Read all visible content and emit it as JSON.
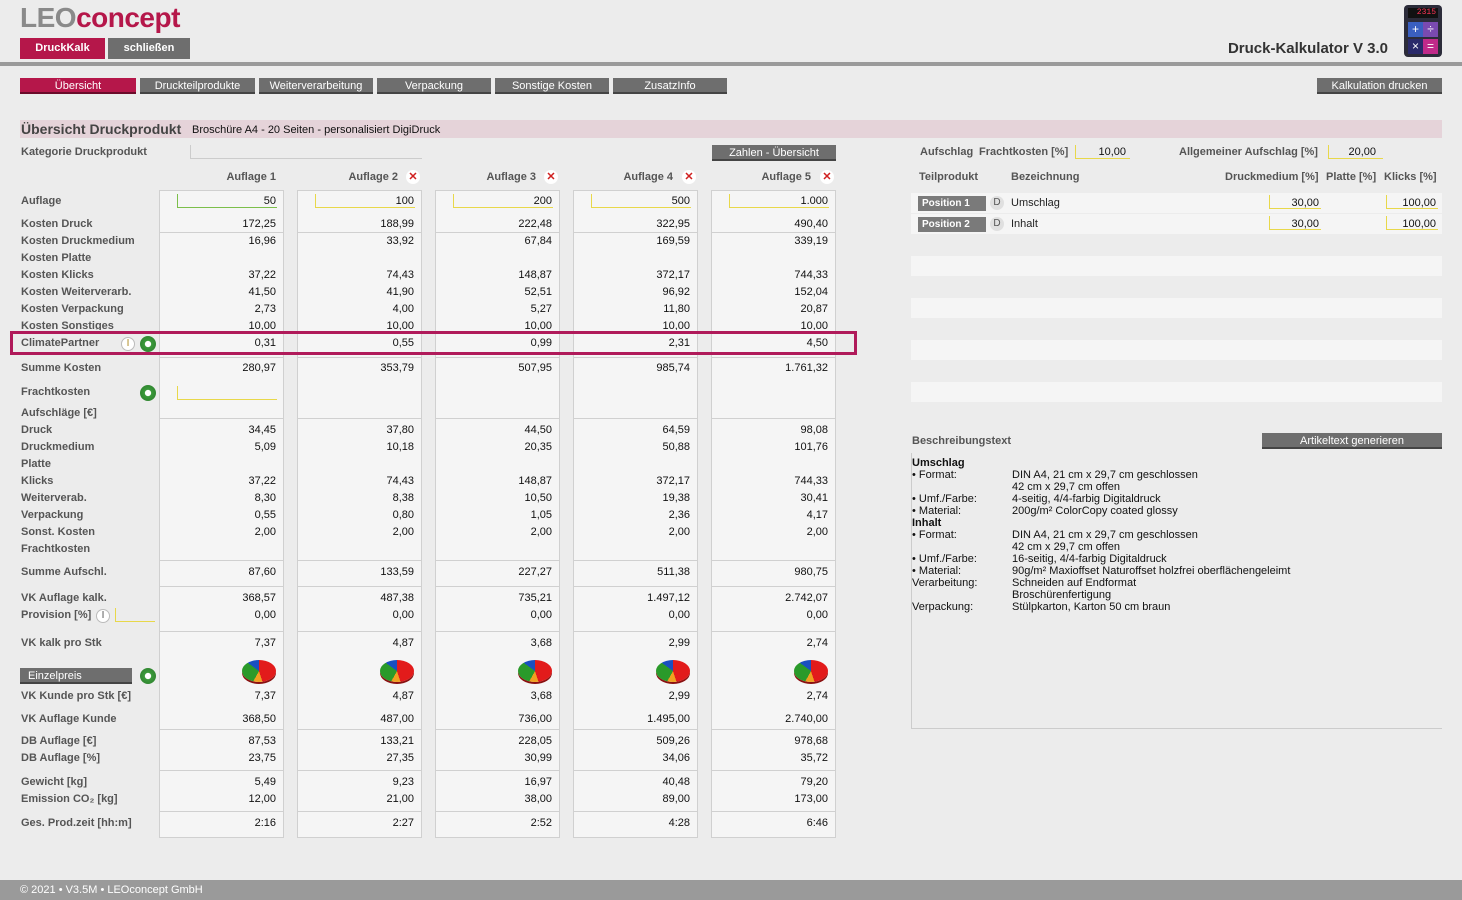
{
  "app": {
    "logo_a": "LEO",
    "logo_b": "concept",
    "title": "Druck-Kalkulator V 3.0",
    "calc_display": "2315",
    "calc_keys": [
      "+",
      "÷",
      "×",
      "="
    ],
    "btn_druckkalk": "DruckKalk",
    "btn_close": "schließen"
  },
  "colors": {
    "accent": "#b5174a",
    "highlight_box": "#b01a5a",
    "tab_gray": "#6e6e6e"
  },
  "tabs": [
    "Übersicht",
    "Druckteilprodukte",
    "Weiterverarbeitung",
    "Verpackung",
    "Sonstige Kosten",
    "ZusatzInfo"
  ],
  "print_button": "Kalkulation drucken",
  "header": {
    "title": "Übersicht Druckprodukt",
    "subtitle": "Broschüre A4 - 20 Seiten - personalisiert DigiDruck"
  },
  "kategorie_label": "Kategorie Druckprodukt",
  "zahlen_button": "Zahlen - Übersicht",
  "labels": {
    "auflage": "Auflage",
    "kosten_druck": "Kosten Druck",
    "kosten_druckmedium": "Kosten Druckmedium",
    "kosten_platte": "Kosten Platte",
    "kosten_klicks": "Kosten Klicks",
    "kosten_weiterverarb": "Kosten Weiterverarb.",
    "kosten_verpackung": "Kosten Verpackung",
    "kosten_sonstiges": "Kosten Sonstiges",
    "climatepartner": "ClimatePartner",
    "summe_kosten": "Summe Kosten",
    "frachtkosten": "Frachtkosten",
    "aufschlaege": "Aufschläge [€]",
    "druck": "Druck",
    "druckmedium": "Druckmedium",
    "platte": "Platte",
    "klicks": "Klicks",
    "weiterverarb": "Weiterverab.",
    "verpackung": "Verpackung",
    "sonst_kosten": "Sonst. Kosten",
    "frachtkosten2": "Frachtkosten",
    "summe_aufschl": "Summe Aufschl.",
    "vk_auflage_kalk": "VK Auflage kalk.",
    "provision": "Provision [%]",
    "vk_kalk_stk": "VK kalk pro Stk",
    "einzelpreis": "Einzelpreis",
    "vk_kunde_stk": "VK Kunde pro Stk [€]",
    "vk_auflage_kunde": "VK Auflage Kunde",
    "db_auflage_eur": "DB Auflage [€]",
    "db_auflage_pct": "DB Auflage [%]",
    "gewicht": "Gewicht [kg]",
    "emission": "Emission CO₂ [kg]",
    "prodzeit": "Ges. Prod.zeit [hh:m]"
  },
  "columns": [
    {
      "head": "Auflage 1",
      "auflage": "50",
      "kosten_druck": "172,25",
      "kosten_druckmedium": "16,96",
      "kosten_klicks": "37,22",
      "kosten_weiterverarb": "41,50",
      "kosten_verpackung": "2,73",
      "kosten_sonstiges": "10,00",
      "climatepartner": "0,31",
      "summe_kosten": "280,97",
      "druck": "34,45",
      "druckmedium": "5,09",
      "klicks": "37,22",
      "weiterverarb": "8,30",
      "verpackung": "0,55",
      "sonst_kosten": "2,00",
      "summe_aufschl": "87,60",
      "vk_auflage_kalk": "368,57",
      "provision": "0,00",
      "vk_kalk_stk": "7,37",
      "vk_kunde_stk": "7,37",
      "vk_auflage_kunde": "368,50",
      "db_auflage_eur": "87,53",
      "db_auflage_pct": "23,75",
      "gewicht": "5,49",
      "emission": "12,00",
      "prodzeit": "2:16"
    },
    {
      "head": "Auflage 2",
      "auflage": "100",
      "kosten_druck": "188,99",
      "kosten_druckmedium": "33,92",
      "kosten_klicks": "74,43",
      "kosten_weiterverarb": "41,90",
      "kosten_verpackung": "4,00",
      "kosten_sonstiges": "10,00",
      "climatepartner": "0,55",
      "summe_kosten": "353,79",
      "druck": "37,80",
      "druckmedium": "10,18",
      "klicks": "74,43",
      "weiterverarb": "8,38",
      "verpackung": "0,80",
      "sonst_kosten": "2,00",
      "summe_aufschl": "133,59",
      "vk_auflage_kalk": "487,38",
      "provision": "0,00",
      "vk_kalk_stk": "4,87",
      "vk_kunde_stk": "4,87",
      "vk_auflage_kunde": "487,00",
      "db_auflage_eur": "133,21",
      "db_auflage_pct": "27,35",
      "gewicht": "9,23",
      "emission": "21,00",
      "prodzeit": "2:27"
    },
    {
      "head": "Auflage 3",
      "auflage": "200",
      "kosten_druck": "222,48",
      "kosten_druckmedium": "67,84",
      "kosten_klicks": "148,87",
      "kosten_weiterverarb": "52,51",
      "kosten_verpackung": "5,27",
      "kosten_sonstiges": "10,00",
      "climatepartner": "0,99",
      "summe_kosten": "507,95",
      "druck": "44,50",
      "druckmedium": "20,35",
      "klicks": "148,87",
      "weiterverarb": "10,50",
      "verpackung": "1,05",
      "sonst_kosten": "2,00",
      "summe_aufschl": "227,27",
      "vk_auflage_kalk": "735,21",
      "provision": "0,00",
      "vk_kalk_stk": "3,68",
      "vk_kunde_stk": "3,68",
      "vk_auflage_kunde": "736,00",
      "db_auflage_eur": "228,05",
      "db_auflage_pct": "30,99",
      "gewicht": "16,97",
      "emission": "38,00",
      "prodzeit": "2:52"
    },
    {
      "head": "Auflage 4",
      "auflage": "500",
      "kosten_druck": "322,95",
      "kosten_druckmedium": "169,59",
      "kosten_klicks": "372,17",
      "kosten_weiterverarb": "96,92",
      "kosten_verpackung": "11,80",
      "kosten_sonstiges": "10,00",
      "climatepartner": "2,31",
      "summe_kosten": "985,74",
      "druck": "64,59",
      "druckmedium": "50,88",
      "klicks": "372,17",
      "weiterverarb": "19,38",
      "verpackung": "2,36",
      "sonst_kosten": "2,00",
      "summe_aufschl": "511,38",
      "vk_auflage_kalk": "1.497,12",
      "provision": "0,00",
      "vk_kalk_stk": "2,99",
      "vk_kunde_stk": "2,99",
      "vk_auflage_kunde": "1.495,00",
      "db_auflage_eur": "509,26",
      "db_auflage_pct": "34,06",
      "gewicht": "40,48",
      "emission": "89,00",
      "prodzeit": "4:28"
    },
    {
      "head": "Auflage 5",
      "auflage": "1.000",
      "kosten_druck": "490,40",
      "kosten_druckmedium": "339,19",
      "kosten_klicks": "744,33",
      "kosten_weiterverarb": "152,04",
      "kosten_verpackung": "20,87",
      "kosten_sonstiges": "10,00",
      "climatepartner": "4,50",
      "summe_kosten": "1.761,32",
      "druck": "98,08",
      "druckmedium": "101,76",
      "klicks": "744,33",
      "weiterverarb": "30,41",
      "verpackung": "4,17",
      "sonst_kosten": "2,00",
      "summe_aufschl": "980,75",
      "vk_auflage_kalk": "2.742,07",
      "provision": "0,00",
      "vk_kalk_stk": "2,74",
      "vk_kunde_stk": "2,74",
      "vk_auflage_kunde": "2.740,00",
      "db_auflage_eur": "978,68",
      "db_auflage_pct": "35,72",
      "gewicht": "79,20",
      "emission": "173,00",
      "prodzeit": "6:46"
    }
  ],
  "right": {
    "aufschlag_label": "Aufschlag",
    "frachtkosten_label": "Frachtkosten [%]",
    "frachtkosten_value": "10,00",
    "allg_aufschlag_label": "Allgemeiner Aufschlag [%]",
    "allg_aufschlag_value": "20,00",
    "table_headers": [
      "Teilprodukt",
      "Bezeichnung",
      "Druckmedium [%]",
      "Platte [%]",
      "Klicks [%]"
    ],
    "positions": [
      {
        "btn": "Position 1",
        "d": "D",
        "name": "Umschlag",
        "druckmedium": "30,00",
        "klicks": "100,00"
      },
      {
        "btn": "Position 2",
        "d": "D",
        "name": "Inhalt",
        "druckmedium": "30,00",
        "klicks": "100,00"
      }
    ],
    "beschreibung_label": "Beschreibungstext",
    "artikeltext_button": "Artikeltext generieren",
    "desc_lines": [
      {
        "k": "Umschlag",
        "v": "",
        "bold": true
      },
      {
        "k": "• Format:",
        "v": "DIN A4, 21 cm x 29,7 cm geschlossen"
      },
      {
        "k": "",
        "v": "42 cm x 29,7 cm offen"
      },
      {
        "k": "• Umf./Farbe:",
        "v": "4-seitig, 4/4-farbig Digitaldruck"
      },
      {
        "k": "• Material:",
        "v": "200g/m² ColorCopy coated glossy"
      },
      {
        "k": "Inhalt",
        "v": "",
        "bold": true
      },
      {
        "k": "• Format:",
        "v": "DIN A4, 21 cm x 29,7 cm geschlossen"
      },
      {
        "k": "",
        "v": "42 cm x 29,7 cm offen"
      },
      {
        "k": "• Umf./Farbe:",
        "v": "16-seitig, 4/4-farbig Digitaldruck"
      },
      {
        "k": "• Material:",
        "v": "90g/m² Maxioffset Naturoffset holzfrei oberflächengeleimt"
      },
      {
        "k": "Verarbeitung:",
        "v": "Schneiden auf Endformat"
      },
      {
        "k": "",
        "v": "Broschürenfertigung"
      },
      {
        "k": "Verpackung:",
        "v": "Stülpkarton, Karton 50 cm braun"
      }
    ]
  },
  "footer": "© 2021 • V3.5M • LEOconcept GmbH"
}
